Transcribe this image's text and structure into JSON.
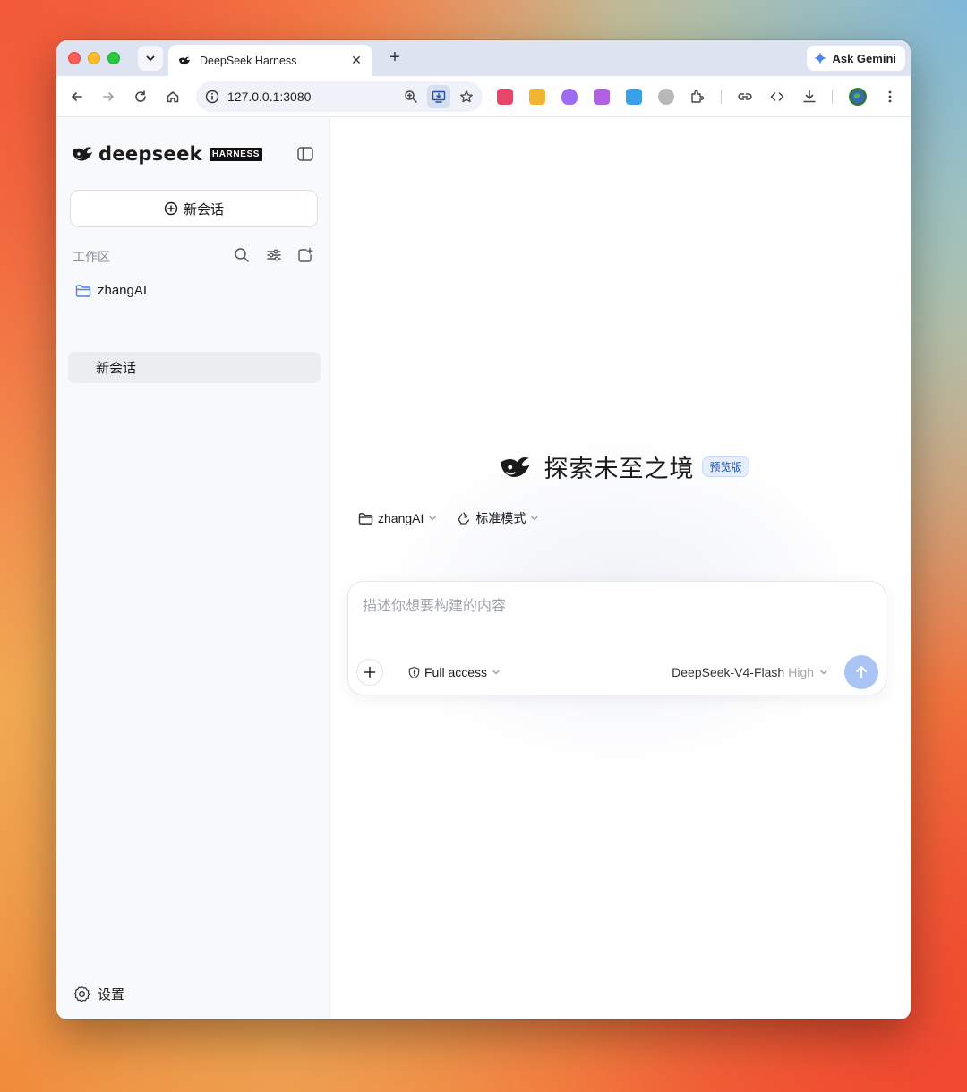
{
  "browser": {
    "tab_title": "DeepSeek Harness",
    "url": "127.0.0.1:3080",
    "ask_gemini_label": "Ask Gemini"
  },
  "sidebar": {
    "logo_text": "deepseek",
    "logo_badge": "HARNESS",
    "new_chat_label": "新会话",
    "workspace_label": "工作区",
    "folder_name": "zhangAI",
    "active_chat": "新会话",
    "settings_label": "设置"
  },
  "main": {
    "hero_title": "探索未至之境",
    "hero_badge": "预览版",
    "project_selector": "zhangAI",
    "mode_selector": "标准模式",
    "composer_placeholder": "描述你想要构建的内容",
    "access_label": "Full access",
    "model_name": "DeepSeek-V4-Flash",
    "effort_level": "High"
  },
  "colors": {
    "accent": "#4a7ff0",
    "send_button": "#a9c4f5",
    "badge_bg": "#e6eefb",
    "badge_text": "#1e4ca8"
  },
  "icons": [
    "search-icon",
    "close-icon",
    "plus-icon",
    "back-icon",
    "forward-icon",
    "reload-icon",
    "home-icon",
    "info-icon",
    "zoom-icon",
    "install-icon",
    "star-icon",
    "extensions-icon",
    "link-icon",
    "code-icon",
    "download-icon",
    "profile-icon",
    "more-icon",
    "whale-logo-icon",
    "sidebar-toggle-icon",
    "new-chat-icon",
    "filter-icon",
    "new-folder-icon",
    "folder-icon",
    "gear-icon",
    "shield-icon",
    "chevron-down-icon",
    "arrow-up-icon"
  ]
}
